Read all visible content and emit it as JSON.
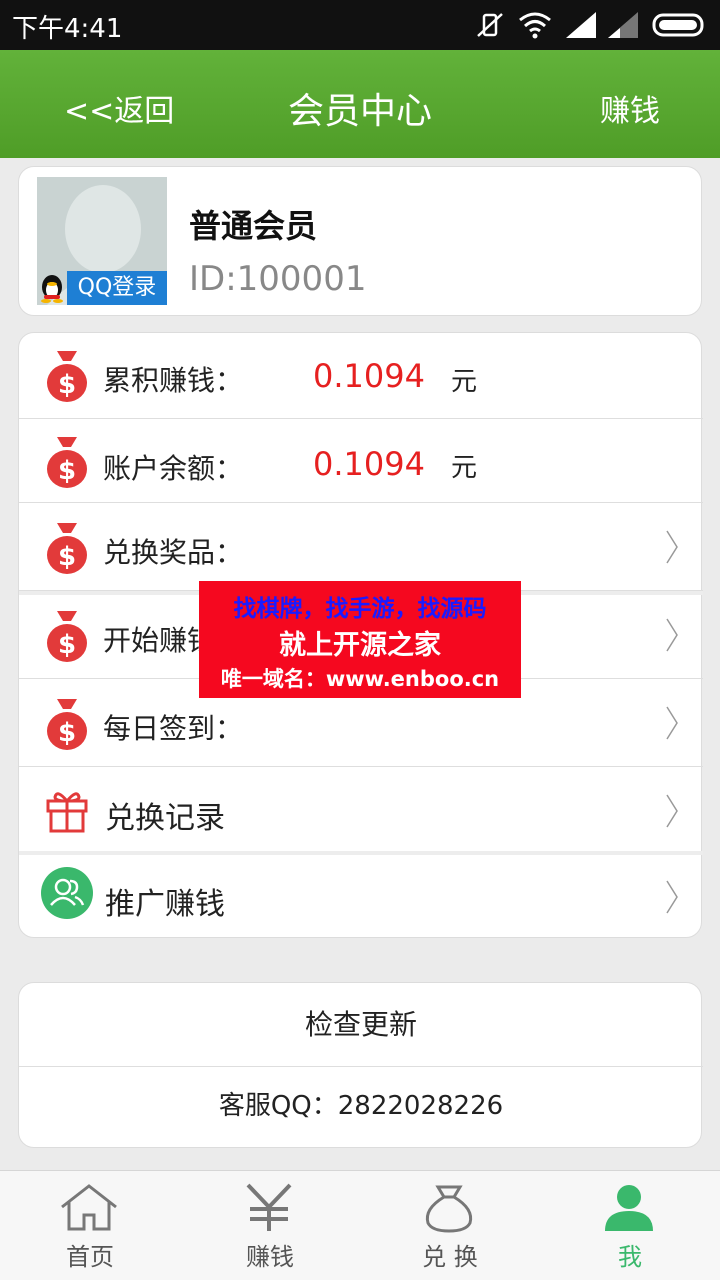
{
  "status_bar": {
    "time": "下午4:41"
  },
  "header": {
    "back_label": "<<返回",
    "title": "会员中心",
    "action_label": "赚钱"
  },
  "profile": {
    "login_badge": "QQ登录",
    "level": "普通会员",
    "id_text": "ID:100001"
  },
  "menu": {
    "total_earned": {
      "label": "累积赚钱：",
      "value": "0.1094",
      "unit": "元"
    },
    "balance": {
      "label": "账户余额：",
      "value": "0.1094",
      "unit": "元"
    },
    "redeem_prizes": {
      "label": "兑换奖品："
    },
    "start_earning": {
      "label": "开始赚钱"
    },
    "daily_checkin": {
      "label": "每日签到："
    },
    "redeem_history": {
      "label": "兑换记录"
    },
    "promote_earn": {
      "label": "推广赚钱"
    }
  },
  "footer_panel": {
    "check_update": "检查更新",
    "service_qq": "客服QQ：2822028226"
  },
  "watermark": {
    "line1": "找棋牌，找手游，找源码",
    "line2": "就上开源之家",
    "line3": "唯一域名：www.enboo.cn"
  },
  "tabs": [
    {
      "label": "首页",
      "icon": "home-icon"
    },
    {
      "label": "赚钱",
      "icon": "yen-icon"
    },
    {
      "label": "兑 换",
      "icon": "money-bag-icon"
    },
    {
      "label": "我",
      "icon": "person-icon"
    }
  ],
  "colors": {
    "header_green": "#5aaa31",
    "value_red": "#e62020",
    "active_tab": "#3ab86c",
    "bag_red": "#e23a3a"
  }
}
